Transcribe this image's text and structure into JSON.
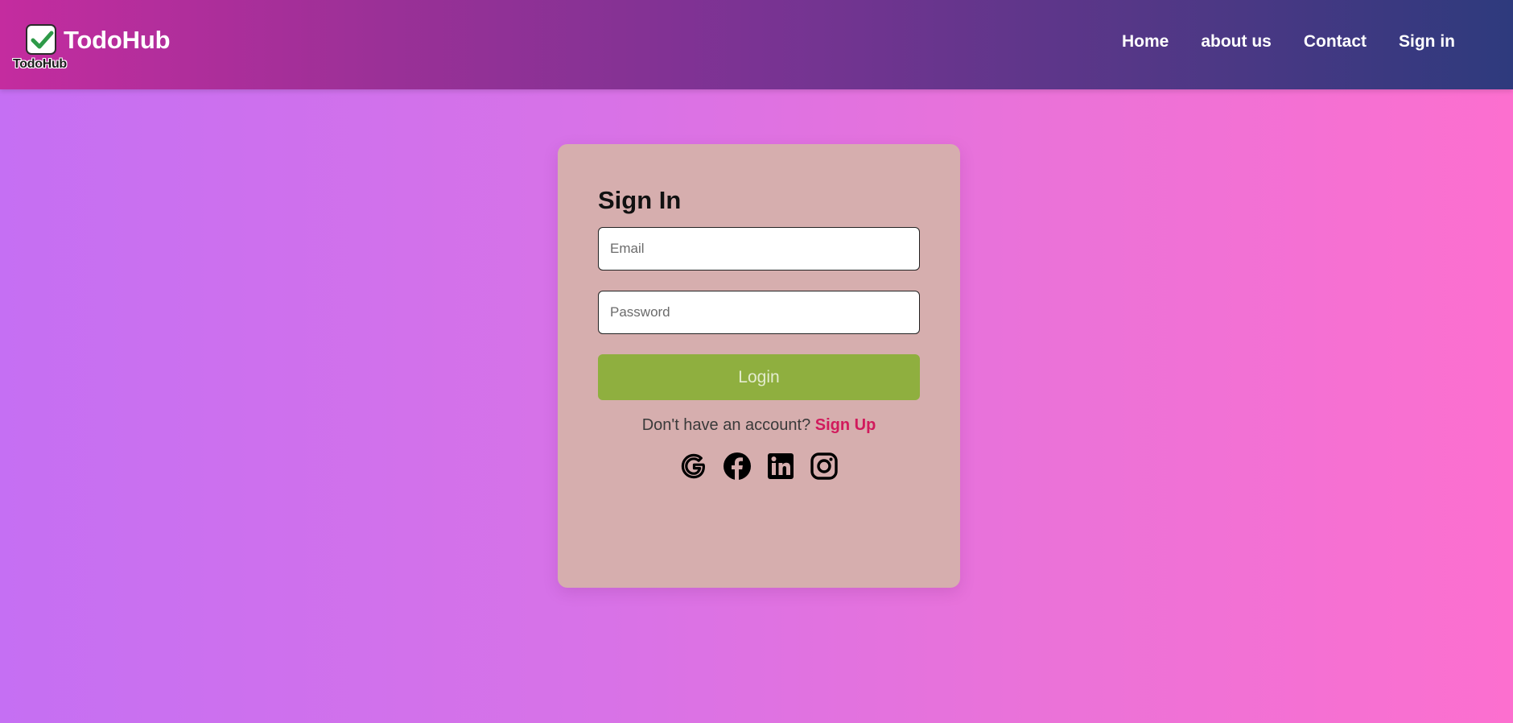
{
  "brand": {
    "name": "TodoHub",
    "logo_caption": "TodoHub",
    "logo_icon": "check-box-icon",
    "logo_check_color": "#2e9a48"
  },
  "nav": {
    "items": [
      {
        "label": "Home"
      },
      {
        "label": "about us"
      },
      {
        "label": "Contact"
      },
      {
        "label": "Sign in"
      }
    ]
  },
  "signin": {
    "title": "Sign In",
    "email_placeholder": "Email",
    "email_value": "",
    "password_placeholder": "Password",
    "password_value": "",
    "login_label": "Login",
    "prompt_text": "Don't have an account? ",
    "signup_label": "Sign Up",
    "social_icons": [
      "google-icon",
      "facebook-icon",
      "linkedin-icon",
      "instagram-icon"
    ]
  },
  "colors": {
    "login_button": "#8faf3f",
    "signup_link": "#d11a5c",
    "card_background": "#d6aeae"
  }
}
